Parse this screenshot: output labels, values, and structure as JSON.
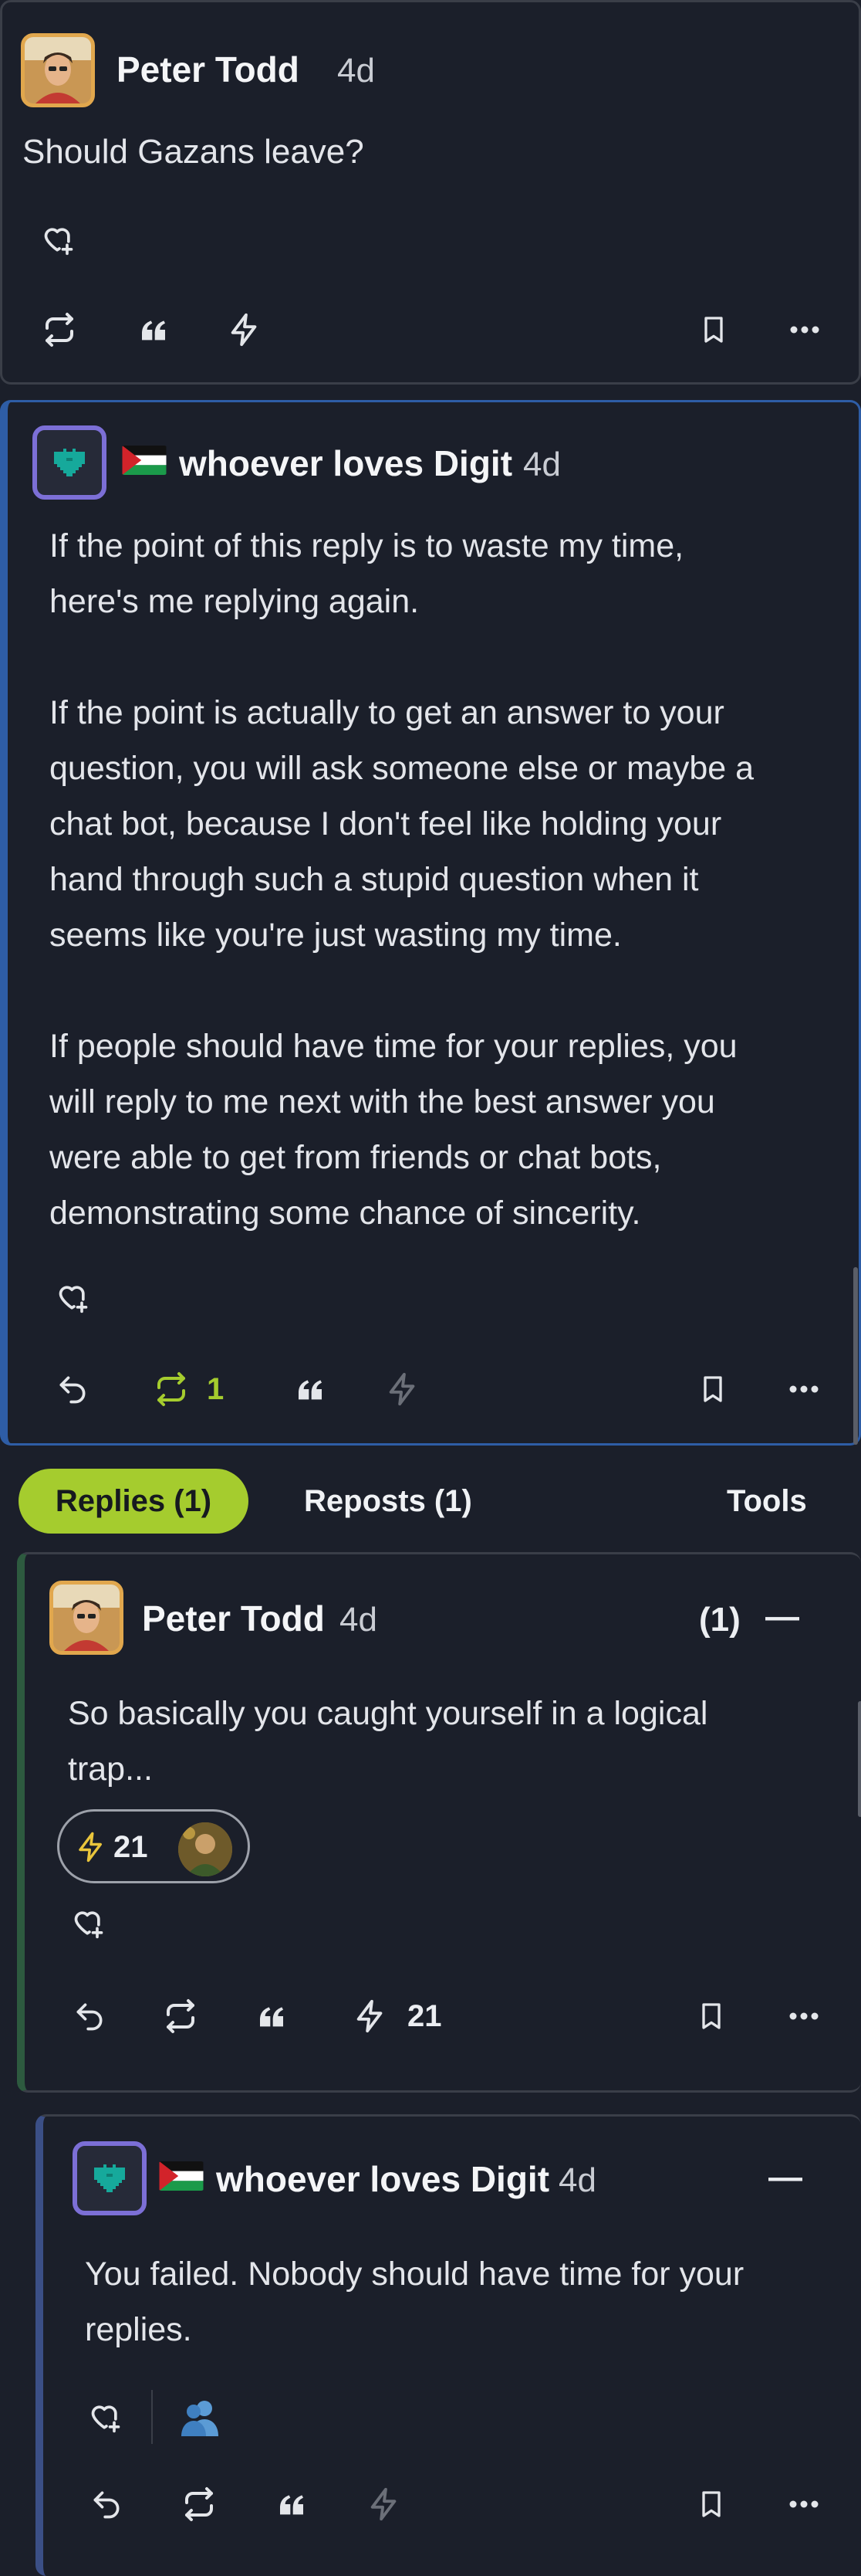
{
  "post1": {
    "author": "Peter Todd",
    "time": "4d",
    "text": "Should Gazans leave?"
  },
  "post2": {
    "author": "whoever loves Digit",
    "time": "4d",
    "paragraph1": "If the point of this reply is to waste my time,\nhere's me replying again.",
    "paragraph2": "If the point is actually to get an answer to your\nquestion, you will ask someone else or maybe a\nchat bot, because I don't feel like holding your\nhand through such a stupid question when it\nseems like you're just wasting my time.",
    "paragraph3": "If people should have time for your replies, you\nwill reply to me next with the best answer you\nwere able to get from friends or chat bots,\ndemonstrating some chance of sincerity.",
    "repost_count": "1"
  },
  "tabs": {
    "replies": "Replies (1)",
    "reposts": "Reposts (1)",
    "tools": "Tools"
  },
  "reply1": {
    "author": "Peter Todd",
    "time": "4d",
    "reply_count": "(1)",
    "collapse": "—",
    "text": "So basically you caught yourself in a logical\ntrap...",
    "zap_pill_count": "21",
    "zap_count": "21"
  },
  "reply2": {
    "author": "whoever loves Digit",
    "time": "4d",
    "collapse": "—",
    "text": "You failed. Nobody should have time for your\nreplies."
  },
  "colors": {
    "background": "#1b1f2a",
    "accent_green": "#a5cc2e",
    "zap_yellow": "#e9c53c",
    "heart_teal": "#16a99b",
    "thread_blue": "#2e5da6"
  }
}
